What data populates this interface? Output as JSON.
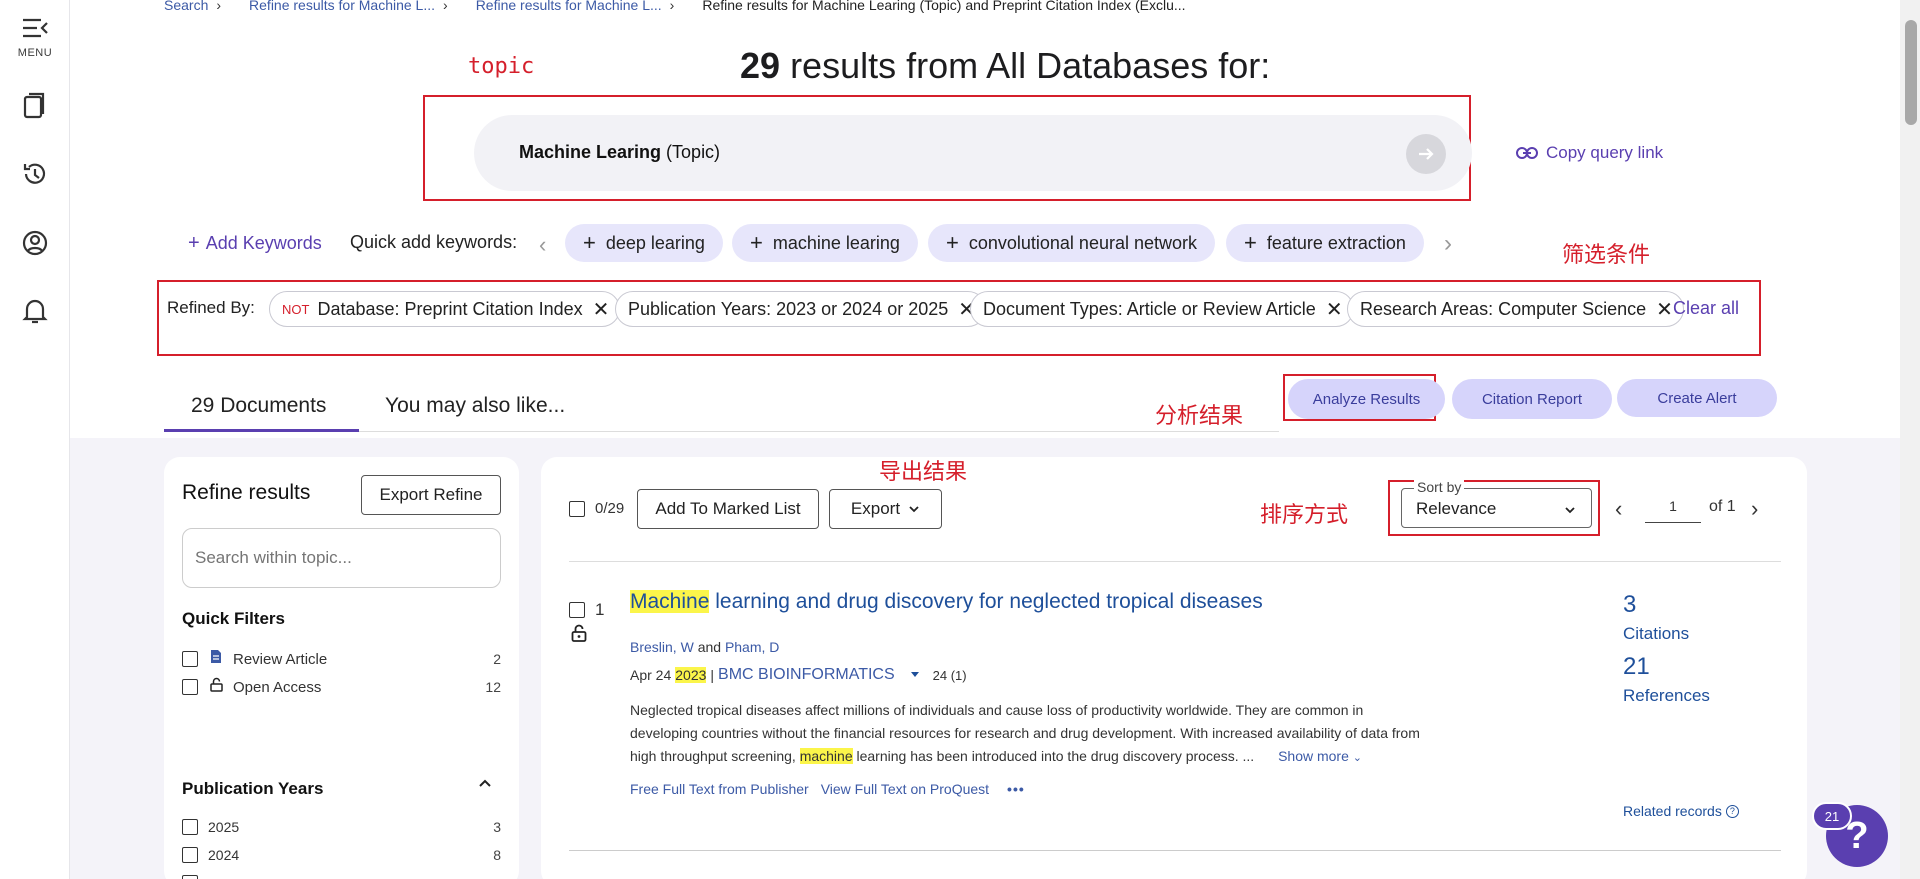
{
  "rail": {
    "menu_label": "MENU"
  },
  "breadcrumb": {
    "items": [
      "Search",
      "Refine results for Machine L...",
      "Refine results for Machine L..."
    ],
    "current": "Refine results for Machine Learing (Topic) and Preprint Citation Index (Exclu..."
  },
  "header": {
    "count": "29",
    "title_rest": "results from All Databases for:"
  },
  "annotations": {
    "topic": "topic",
    "filters": "筛选条件",
    "analyze": "分析结果",
    "export": "导出结果",
    "sort": "排序方式"
  },
  "query": {
    "term": "Machine Learing",
    "field": "(Topic)",
    "copy_link": "Copy query link"
  },
  "keywords": {
    "add_label": "Add Keywords",
    "quick_label": "Quick add keywords:",
    "items": [
      "deep learing",
      "machine learing",
      "convolutional neural network",
      "feature extraction"
    ]
  },
  "refined": {
    "label": "Refined By:",
    "not_tag": "NOT",
    "chips": [
      "Database: Preprint Citation Index",
      "Publication Years: 2023 or 2024 or 2025",
      "Document Types: Article or Review Article",
      "Research Areas: Computer Science"
    ],
    "clear_all": "Clear all"
  },
  "tabs": {
    "documents_count": "29",
    "documents_label": "Documents",
    "also_like": "You may also like..."
  },
  "actions": {
    "analyze": "Analyze Results",
    "citation_report": "Citation Report",
    "create_alert": "Create Alert"
  },
  "refine_panel": {
    "title": "Refine results",
    "export_refine": "Export Refine",
    "search_placeholder": "Search within topic...",
    "quick_filters_title": "Quick Filters",
    "quick_filters": [
      {
        "label": "Review Article",
        "count": "2",
        "icon": "document-icon"
      },
      {
        "label": "Open Access",
        "count": "12",
        "icon": "unlock-icon"
      }
    ],
    "pub_years_title": "Publication Years",
    "years": [
      {
        "label": "2025",
        "count": "3"
      },
      {
        "label": "2024",
        "count": "8"
      }
    ]
  },
  "toolbar": {
    "selected": "0/29",
    "add_marked": "Add To Marked List",
    "export": "Export",
    "sort_legend": "Sort by",
    "sort_value": "Relevance",
    "page_value": "1",
    "page_of": "of 1"
  },
  "record": {
    "index": "1",
    "title_hl": "Machine",
    "title_rest": " learning and drug discovery for neglected tropical diseases",
    "author1": "Breslin, W",
    "and": "and",
    "author2": "Pham, D",
    "date": "Apr 24",
    "year": "2023",
    "journal": "BMC BIOINFORMATICS",
    "volume": "24 (1)",
    "abstract_1": "Neglected tropical diseases affect millions of individuals and cause loss of productivity worldwide. They are common in",
    "abstract_2": "developing countries without the financial resources for research and drug development. With increased availability of data from",
    "abstract_3a": "high throughput screening, ",
    "abstract_3_hl": "machine",
    "abstract_3b": " learning has been introduced into the drug discovery process.  ...",
    "show_more": "Show more",
    "link_publisher": "Free Full Text from Publisher",
    "link_proquest": "View Full Text on ProQuest",
    "citations_count": "3",
    "citations_label": "Citations",
    "references_count": "21",
    "references_label": "References",
    "related": "Related records"
  },
  "help": {
    "badge": "21"
  }
}
